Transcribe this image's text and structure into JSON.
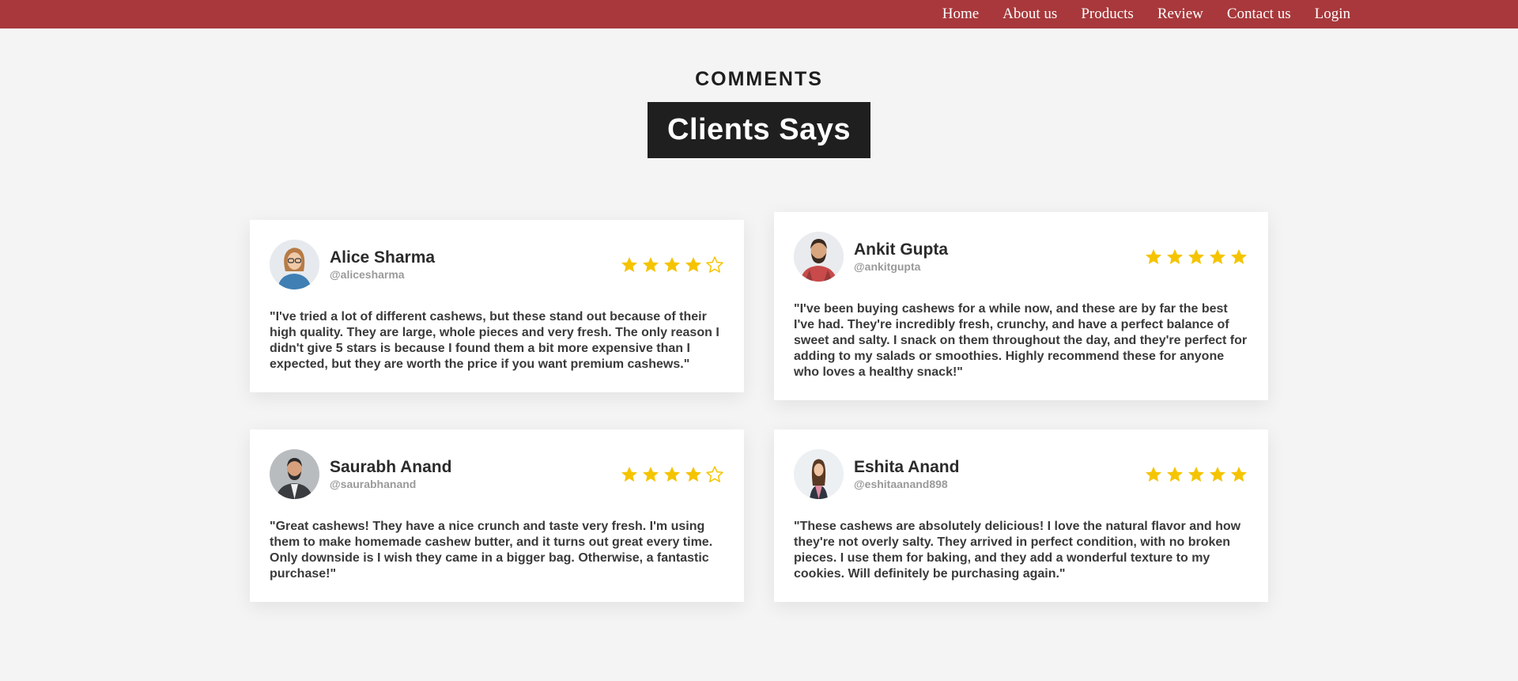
{
  "nav": {
    "items": [
      {
        "label": "Home"
      },
      {
        "label": "About us"
      },
      {
        "label": "Products"
      },
      {
        "label": "Review"
      },
      {
        "label": "Contact us"
      },
      {
        "label": "Login"
      }
    ]
  },
  "header": {
    "label": "COMMENTS",
    "title": "Clients Says"
  },
  "colors": {
    "navbar": "#a8383b",
    "title_bg": "#1f1f1f",
    "star": "#f5c400"
  },
  "reviews": [
    {
      "name": "Alice Sharma",
      "handle": "@alicesharma",
      "rating": 4,
      "max_rating": 5,
      "avatar_icon": "woman-glasses-avatar",
      "text": "\"I've tried a lot of different cashews, but these stand out because of their high quality. They are large, whole pieces and very fresh. The only reason I didn't give 5 stars is because I found them a bit more expensive than I expected, but they are worth the price if you want premium cashews.\""
    },
    {
      "name": "Ankit Gupta",
      "handle": "@ankitgupta",
      "rating": 5,
      "max_rating": 5,
      "avatar_icon": "man-beard-avatar",
      "text": "\"I've been buying cashews for a while now, and these are by far the best I've had. They're incredibly fresh, crunchy, and have a perfect balance of sweet and salty. I snack on them throughout the day, and they're perfect for adding to my salads or smoothies. Highly recommend these for anyone who loves a healthy snack!\""
    },
    {
      "name": "Saurabh Anand",
      "handle": "@saurabhanand",
      "rating": 4,
      "max_rating": 5,
      "avatar_icon": "man-suit-avatar",
      "text": "\"Great cashews! They have a nice crunch and taste very fresh. I'm using them to make homemade cashew butter, and it turns out great every time. Only downside is I wish they came in a bigger bag. Otherwise, a fantastic purchase!\""
    },
    {
      "name": "Eshita Anand",
      "handle": "@eshitaanand898",
      "rating": 5,
      "max_rating": 5,
      "avatar_icon": "woman-avatar",
      "text": "\"These cashews are absolutely delicious! I love the natural flavor and how they're not overly salty. They arrived in perfect condition, with no broken pieces. I use them for baking, and they add a wonderful texture to my cookies. Will definitely be purchasing again.\""
    }
  ]
}
